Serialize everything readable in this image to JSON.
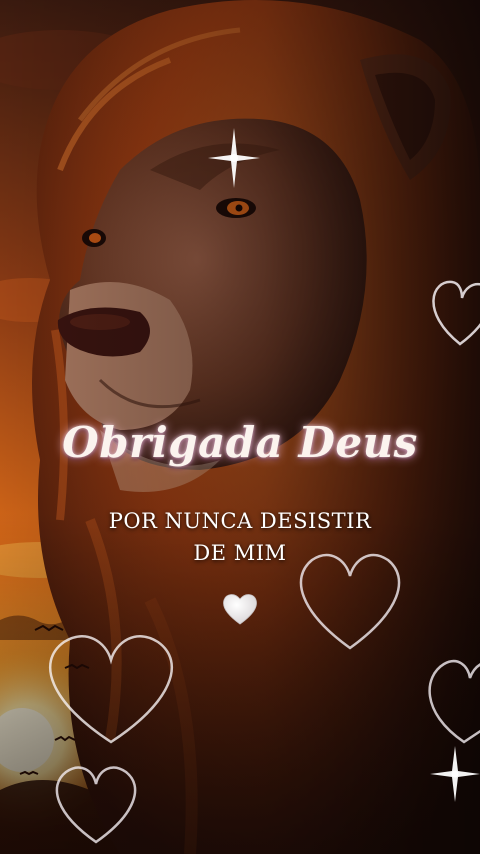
{
  "overlay": {
    "title": "Obrigada Deus",
    "subtitle_line1": "POR NUNCA DESISTIR",
    "subtitle_line2": "DE MIM"
  },
  "decorations": {
    "center_heart": "white-heart-icon",
    "outline_hearts": "heart-outline-icon",
    "sparkles": "sparkle-icon"
  },
  "colors": {
    "sky_top": "#3a1a0f",
    "sunset_orange": "#e8891f",
    "sun_glow": "#fff2c4",
    "mane": "#b04a14",
    "lion_face": "#6b3a26",
    "shadow": "#1a0b08",
    "heart_outline": "#f4eef2"
  }
}
